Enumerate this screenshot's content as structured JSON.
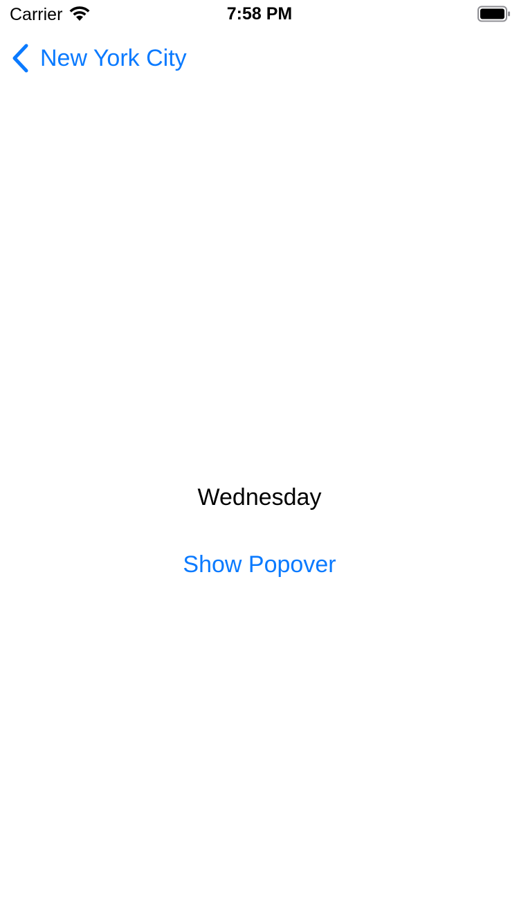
{
  "status_bar": {
    "carrier": "Carrier",
    "time": "7:58 PM",
    "wifi_icon": "wifi-icon",
    "battery_icon": "battery-icon"
  },
  "nav": {
    "back_label": "New York City",
    "back_icon": "chevron-left-icon"
  },
  "main": {
    "day": "Wednesday",
    "popover_button_label": "Show Popover"
  },
  "colors": {
    "accent": "#0a7aff",
    "text": "#000000",
    "background": "#ffffff"
  }
}
